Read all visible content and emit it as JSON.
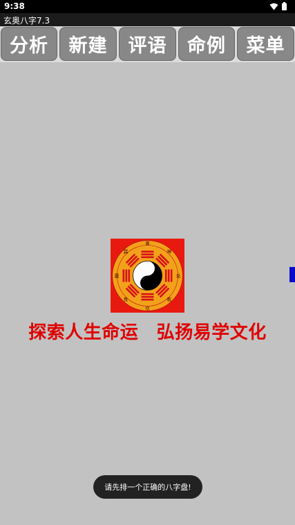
{
  "status_bar": {
    "time": "9:38",
    "wifi_icon": "wifi-icon",
    "battery_icon": "battery-icon"
  },
  "title_bar": {
    "title": "玄奥八字7.3"
  },
  "toolbar": {
    "buttons": [
      {
        "label": "分析"
      },
      {
        "label": "新建"
      },
      {
        "label": "评语"
      },
      {
        "label": "命例"
      },
      {
        "label": "菜单"
      }
    ]
  },
  "logo": {
    "icon": "bagua-taiji-icon",
    "trigrams": [
      "离",
      "坤",
      "兑",
      "乾",
      "坎",
      "艮",
      "震",
      "巽"
    ]
  },
  "slogan": "探索人生命运　弘扬易学文化",
  "toast": "请先排一个正确的八字盘!",
  "colors": {
    "background": "#c2c2c2",
    "slogan": "#e00000",
    "toolbar_button": "#888888",
    "side_tab": "#0a0acc"
  }
}
